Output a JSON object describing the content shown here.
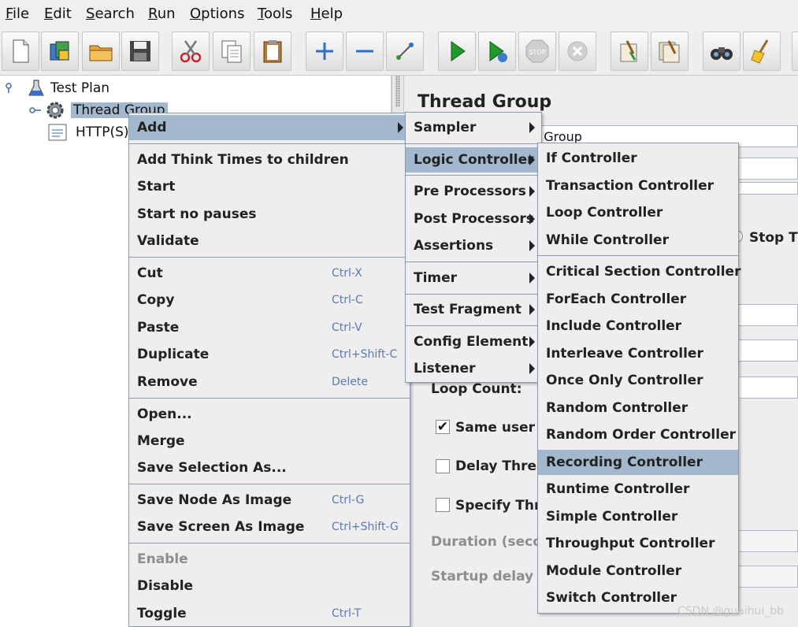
{
  "menubar": {
    "items": [
      {
        "mn": "F",
        "rest": "ile"
      },
      {
        "mn": "E",
        "rest": "dit"
      },
      {
        "mn": "S",
        "rest": "earch"
      },
      {
        "mn": "R",
        "rest": "un"
      },
      {
        "mn": "O",
        "rest": "ptions"
      },
      {
        "mn": "T",
        "rest": "ools"
      },
      {
        "mn": "H",
        "rest": "elp"
      }
    ]
  },
  "toolbar": {
    "icons": [
      "new-icon",
      "templates-icon",
      "open-icon",
      "save-icon",
      "cut-icon",
      "copy-icon",
      "paste-icon",
      "expand-icon",
      "collapse-icon",
      "toggle-icon",
      "start-icon",
      "start-no-pauses-icon",
      "stop-icon",
      "shutdown-icon",
      "clear-icon",
      "clear-all-icon",
      "search-icon",
      "reset-search-icon"
    ]
  },
  "tree": {
    "test_plan": "Test Plan",
    "thread_group": "Thread Group",
    "http": "HTTP(S)"
  },
  "panel": {
    "title": "Thread Group",
    "name_value": "d Group",
    "stop_label": "Stop Th",
    "loop_count": "Loop Count:",
    "same_user": "Same user o",
    "delay_thread": "Delay Threa",
    "specify_thread": "Specify Thre",
    "duration": "Duration (secon",
    "startup_delay": "Startup delay (s"
  },
  "context_menu": {
    "add": "Add",
    "think_times": "Add Think Times to children",
    "start": "Start",
    "start_no_pauses": "Start no pauses",
    "validate": "Validate",
    "cut": "Cut",
    "cut_key": "Ctrl-X",
    "copy": "Copy",
    "copy_key": "Ctrl-C",
    "paste": "Paste",
    "paste_key": "Ctrl-V",
    "duplicate": "Duplicate",
    "duplicate_key": "Ctrl+Shift-C",
    "remove": "Remove",
    "remove_key": "Delete",
    "open": "Open...",
    "merge": "Merge",
    "save_selection": "Save Selection As...",
    "save_node_image": "Save Node As Image",
    "save_node_image_key": "Ctrl-G",
    "save_screen_image": "Save Screen As Image",
    "save_screen_image_key": "Ctrl+Shift-G",
    "enable": "Enable",
    "disable": "Disable",
    "toggle": "Toggle",
    "toggle_key": "Ctrl-T"
  },
  "add_menu": {
    "sampler": "Sampler",
    "logic_controller": "Logic Controller",
    "pre_processors": "Pre Processors",
    "post_processors": "Post Processors",
    "assertions": "Assertions",
    "timer": "Timer",
    "test_fragment": "Test Fragment",
    "config_element": "Config Element",
    "listener": "Listener"
  },
  "logic_menu": {
    "items": [
      "If Controller",
      "Transaction Controller",
      "Loop Controller",
      "While Controller",
      "Critical Section Controller",
      "ForEach Controller",
      "Include Controller",
      "Interleave Controller",
      "Once Only Controller",
      "Random Controller",
      "Random Order Controller",
      "Recording Controller",
      "Runtime Controller",
      "Simple Controller",
      "Throughput Controller",
      "Module Controller",
      "Switch Controller"
    ],
    "selected": "Recording Controller"
  },
  "colors": {
    "selection": "#a3b8cc",
    "menu_border": "#8a99ae",
    "accelerator": "#5a7ab0"
  },
  "watermark": "CSDN @guaihui_bb"
}
